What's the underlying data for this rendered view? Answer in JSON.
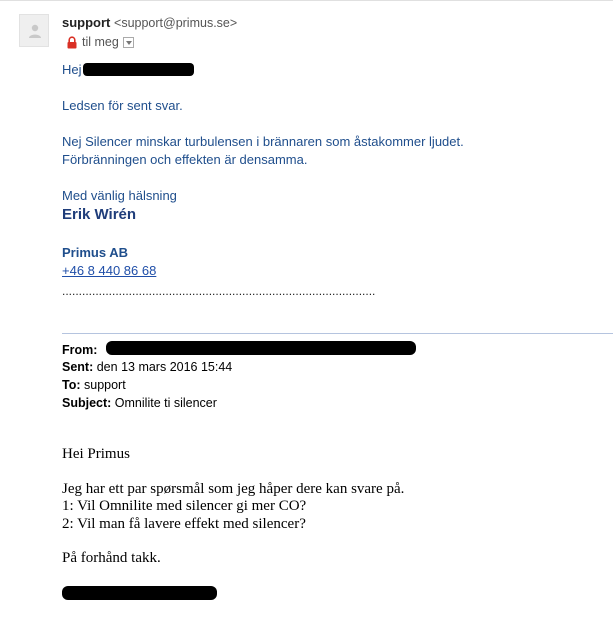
{
  "sender": {
    "name": "support",
    "email": "<support@primus.se>",
    "to_label": "til meg"
  },
  "reply": {
    "greeting": "Hej",
    "line1": "Ledsen för sent svar.",
    "para_line1": "Nej Silencer minskar turbulensen i brännaren som åstakommer ljudet.",
    "para_line2": "Förbränningen och effekten är densamma.",
    "closing": "Med vänlig hälsning",
    "signature_name": "Erik Wirén",
    "company": "Primus AB",
    "phone": "+46 8 440 86 68",
    "dotted_line": ".............................................................................................."
  },
  "quoted_header": {
    "from_label": "From:",
    "sent_label": "Sent:",
    "sent_value": "den 13 mars 2016 15:44",
    "to_label": "To:",
    "to_value": "support",
    "subject_label": "Subject:",
    "subject_value": "Omnilite ti silencer"
  },
  "quoted_body": {
    "greeting": "Hei Primus",
    "line1": "Jeg har ett par spørsmål som jeg håper dere kan svare på.",
    "line2": "1: Vil Omnilite med silencer gi mer CO?",
    "line3": "2: Vil man få lavere effekt med silencer?",
    "thanks": "På forhånd takk."
  },
  "icons": {
    "avatar": "person-icon",
    "lock": "lock-icon",
    "dropdown": "chevron-down-icon"
  },
  "colors": {
    "body_blue": "#1f4e8c",
    "signature_blue": "#1f3d7a",
    "link_blue": "#1f4ea8",
    "lock_red": "#d93025"
  }
}
